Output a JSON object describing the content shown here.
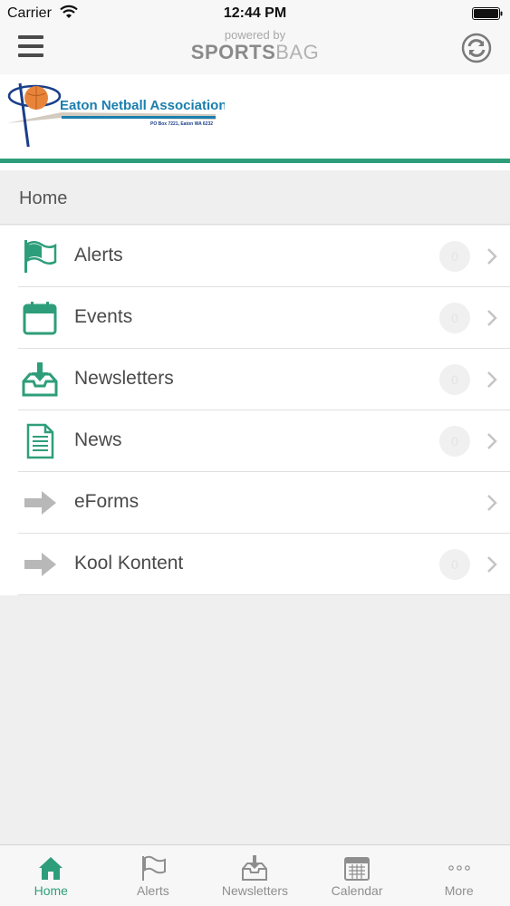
{
  "status_bar": {
    "carrier": "Carrier",
    "time": "12:44 PM"
  },
  "header": {
    "powered_by": "powered by",
    "brand_bold": "SPORTS",
    "brand_light": "BAG"
  },
  "banner": {
    "org_name": "Eaton Netball Association",
    "address": "PO Box 7221, Eaton WA 6232"
  },
  "section": {
    "title": "Home"
  },
  "menu": {
    "items": [
      {
        "label": "Alerts",
        "badge": "0",
        "icon": "flag-icon"
      },
      {
        "label": "Events",
        "badge": "0",
        "icon": "calendar-icon"
      },
      {
        "label": "Newsletters",
        "badge": "0",
        "icon": "inbox-download-icon"
      },
      {
        "label": "News",
        "badge": "0",
        "icon": "document-icon"
      },
      {
        "label": "eForms",
        "badge": "",
        "icon": "arrow-right-icon"
      },
      {
        "label": "Kool Kontent",
        "badge": "0",
        "icon": "arrow-right-icon"
      }
    ]
  },
  "tabs": [
    {
      "label": "Home",
      "icon": "home-icon",
      "active": true
    },
    {
      "label": "Alerts",
      "icon": "flag-icon",
      "active": false
    },
    {
      "label": "Newsletters",
      "icon": "inbox-download-icon",
      "active": false
    },
    {
      "label": "Calendar",
      "icon": "calendar-icon",
      "active": false
    },
    {
      "label": "More",
      "icon": "more-icon",
      "active": false
    }
  ],
  "colors": {
    "accent": "#2e9e7a",
    "muted_icon": "#b8b8b8",
    "logo_text": "#1a7fae"
  }
}
